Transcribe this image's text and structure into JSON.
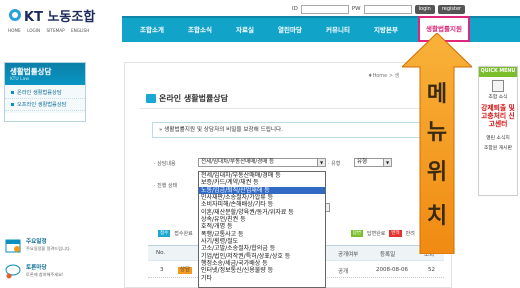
{
  "header": {
    "logo_text": "KT 노동조합",
    "top_links": [
      "HOME",
      "LOGIN",
      "SITEMAP",
      "ENGLISH"
    ],
    "login": {
      "id_label": "ID",
      "pw_label": "PW",
      "login_btn": "login",
      "register_btn": "register"
    }
  },
  "nav": {
    "items": [
      "조합소개",
      "조합소식",
      "자료실",
      "열린마당",
      "커뮤니티",
      "지방본부",
      "생활법률지원"
    ],
    "active_color": "#e0267a",
    "bar_color": "#12a3c8"
  },
  "sidebar": {
    "title": "생활법률상담",
    "subtitle": "KTU Law",
    "items": [
      "온라인 생활법률상담",
      "오프라인 생활법률상담"
    ],
    "box1": {
      "title": "주요일정",
      "desc": "주요일정을 알려드립니다."
    },
    "box2": {
      "title": "토론마당",
      "desc": "토론에 참여해주세요!"
    }
  },
  "main": {
    "breadcrumb": "Home > 생",
    "page_title": "온라인 생활법률상담",
    "notice": "» 생활법률지원 및 상담자의 비밀을 보장해 드립니다.",
    "form": {
      "category_label": "· 상담내용",
      "category_value": "전세/임대차/부동산매매/경매 등",
      "type_label": "· 유형",
      "type_value": "유형",
      "progress_label": "· 진행 상태",
      "dropdown_options": [
        "전세/임대차/부동산매매/경매 등",
        "보증/카드/계약/채권 등",
        "노동/임금/퇴직/산업재해 등",
        "민사재판/소송절차/가압류 등",
        "소비자피해/손해배상/기타 등",
        "이혼/재산분할/양육권/동거/위자료 등",
        "상속/유언/친권 등",
        "호적/개명 등",
        "폭행/교통사고 등",
        "사기/횡령/절도",
        "고소/고발/소송절차/합의금 등",
        "기업/법인/저작권/특허/상표/상호 등",
        "행정소송/세금/국가배상 등",
        "인터넷/정보통신/신용불량 등",
        "기타"
      ],
      "selected_index": 2,
      "search_btn": "검색"
    },
    "legend": {
      "count_badge": "접수",
      "count_text": "접수완료",
      "answered_badge": "답변",
      "answered_text": "답변완료",
      "return_badge": "반려",
      "return_text": "반려"
    },
    "table": {
      "headers": [
        "No.",
        "공개여부",
        "등록일",
        "조회"
      ],
      "rows": [
        {
          "no": "3",
          "badge": "상담",
          "public": "공개",
          "date": "2008-08-06",
          "views": "52"
        }
      ]
    }
  },
  "annotation": {
    "text_chars": [
      "메",
      "뉴",
      "위",
      "치"
    ]
  },
  "quick_menu": {
    "title": "QUICK MENU",
    "items": [
      "조합 소식"
    ],
    "red_text": "강제퇴출 및 고충처리 신고센터",
    "bottom_items": [
      "열린 소식지",
      "조합원 게시판"
    ]
  }
}
